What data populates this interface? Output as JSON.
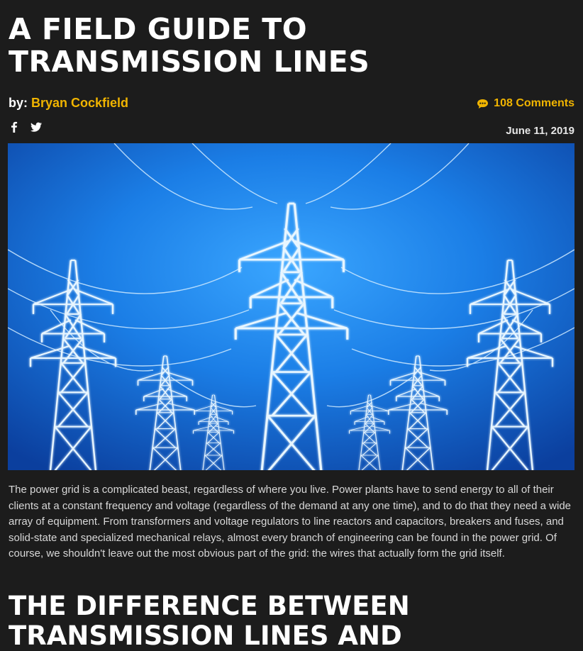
{
  "article": {
    "title_line1": "A FIELD GUIDE TO",
    "title_line2": "TRANSMISSION LINES",
    "byline_prefix": "by:",
    "author": "Bryan Cockfield",
    "comments": "108 Comments",
    "date": "June 11, 2019",
    "intro": "The power grid is a complicated beast, regardless of where you live. Power plants have to send energy to all of their clients at a constant frequency and voltage (regardless of the demand at any one time), and to do that they need a wide array of equipment. From transformers and voltage regulators to line reactors and capacitors, breakers and fuses, and solid-state and specialized mechanical relays, almost every branch of engineering can be found in the power grid. Of course, we shouldn't leave out the most obvious part of the grid: the wires that actually form the grid itself.",
    "subheading_line1": "THE DIFFERENCE BETWEEN",
    "subheading_line2": "TRANSMISSION LINES AND"
  },
  "social": {
    "icons": [
      "facebook-icon",
      "twitter-icon"
    ]
  },
  "hero_image": {
    "subject": "transmission towers",
    "colors": {
      "bg_dark": "#0a3c9a",
      "bg_light": "#2a8ef0",
      "tower": "#e8f6ff"
    }
  },
  "colors": {
    "background": "#1c1c1c",
    "accent": "#f0b400",
    "text": "#e6e6e6",
    "heading": "#ffffff"
  }
}
